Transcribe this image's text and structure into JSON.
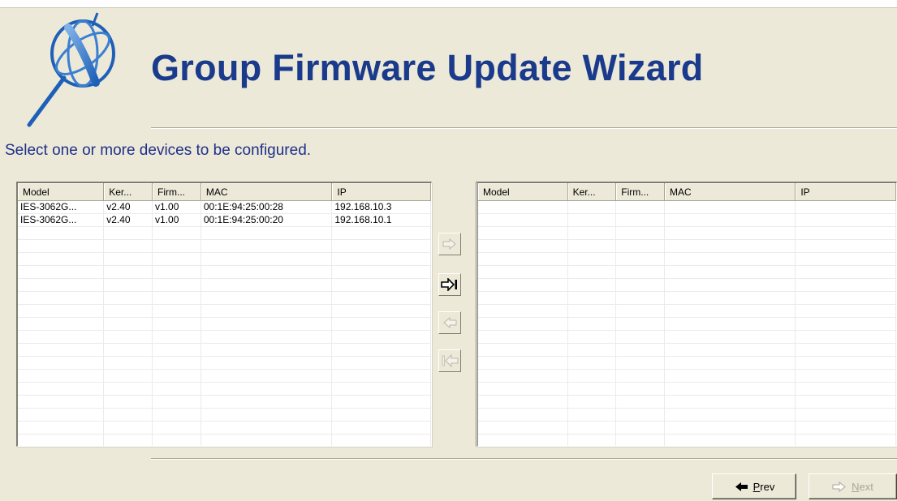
{
  "wizard": {
    "title": "Group Firmware Update Wizard",
    "subtitle": "Select one or more devices to be configured.",
    "accent_color": "#1a3a8c"
  },
  "left_list": {
    "columns": [
      "Model",
      "Ker...",
      "Firm...",
      "MAC",
      "IP"
    ],
    "rows": [
      [
        "IES-3062G...",
        "v2.40",
        "v1.00",
        "00:1E:94:25:00:28",
        "192.168.10.3"
      ],
      [
        "IES-3062G...",
        "v2.40",
        "v1.00",
        "00:1E:94:25:00:20",
        "192.168.10.1"
      ]
    ]
  },
  "right_list": {
    "columns": [
      "Model",
      "Ker...",
      "Firm...",
      "MAC",
      "IP"
    ],
    "rows": []
  },
  "transfer_buttons": [
    {
      "icon": "arrow-right-icon",
      "enabled": false
    },
    {
      "icon": "arrow-right-all-icon",
      "enabled": true
    },
    {
      "icon": "arrow-left-icon",
      "enabled": false
    },
    {
      "icon": "arrow-left-all-icon",
      "enabled": false
    }
  ],
  "navigation": {
    "prev_label": "Prev",
    "next_label": "Next",
    "next_enabled": false
  }
}
